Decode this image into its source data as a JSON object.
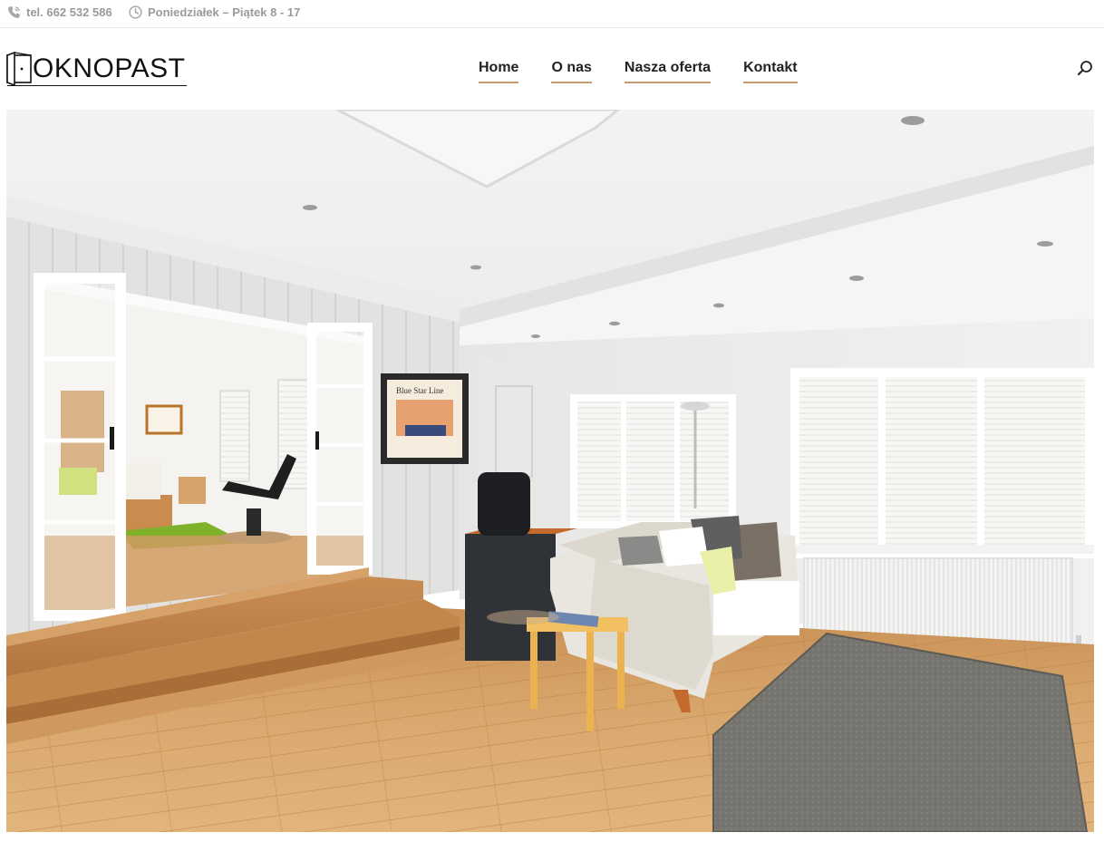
{
  "topbar": {
    "phone": "tel. 662 532 586",
    "hours": "Poniedziałek – Piątek 8 - 17",
    "phone_icon": "phone-icon",
    "clock_icon": "clock-icon"
  },
  "header": {
    "logo_text": "OKNOPAST",
    "search_icon": "search-icon"
  },
  "nav": {
    "items": [
      {
        "label": "Home"
      },
      {
        "label": "O nas"
      },
      {
        "label": "Nasza oferta"
      },
      {
        "label": "Kontakt"
      }
    ]
  },
  "hero": {
    "poster_text": "Blue Star Line"
  },
  "colors": {
    "accent": "#c89b6d",
    "muted_text": "#9a9a9a",
    "nav_text": "#222222"
  }
}
